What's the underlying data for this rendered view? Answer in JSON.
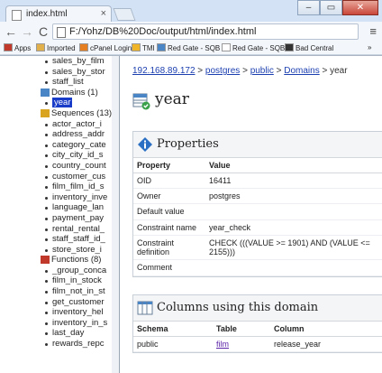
{
  "window": {
    "tab_title": "index.html",
    "tab_close": "×",
    "min": "–",
    "restore": "▭",
    "close": "✕"
  },
  "toolbar": {
    "back": "←",
    "forward": "→",
    "reload": "C",
    "url": "F:/Yohz/DB%20Doc/output/html/index.html",
    "menu": "≡"
  },
  "bookmarks": [
    {
      "label": "Apps",
      "color": "#c0392b"
    },
    {
      "label": "Imported",
      "color": "#e2b04a"
    },
    {
      "label": "cPanel Login",
      "color": "#e67e22"
    },
    {
      "label": "TMI",
      "color": "#f0b429"
    },
    {
      "label": "Red Gate - SQB 6",
      "color": "#4a86c5"
    },
    {
      "label": "Red Gate - SQB 7",
      "color": "#ffffff"
    },
    {
      "label": "Bad Central",
      "color": "#333333"
    }
  ],
  "bookmarks_more": "»",
  "tree": [
    {
      "kind": "leaf",
      "label": "sales_by_film"
    },
    {
      "kind": "leaf",
      "label": "sales_by_stor"
    },
    {
      "kind": "leaf",
      "label": "staff_list"
    },
    {
      "kind": "group",
      "label": "Domains (1)",
      "icon": "domains-icon"
    },
    {
      "kind": "leaf",
      "label": "year",
      "selected": true
    },
    {
      "kind": "group",
      "label": "Sequences (13)",
      "icon": "sequences-icon"
    },
    {
      "kind": "leaf",
      "label": "actor_actor_i"
    },
    {
      "kind": "leaf",
      "label": "address_addr"
    },
    {
      "kind": "leaf",
      "label": "category_cate"
    },
    {
      "kind": "leaf",
      "label": "city_city_id_s"
    },
    {
      "kind": "leaf",
      "label": "country_count"
    },
    {
      "kind": "leaf",
      "label": "customer_cus"
    },
    {
      "kind": "leaf",
      "label": "film_film_id_s"
    },
    {
      "kind": "leaf",
      "label": "inventory_inve"
    },
    {
      "kind": "leaf",
      "label": "language_lan"
    },
    {
      "kind": "leaf",
      "label": "payment_pay"
    },
    {
      "kind": "leaf",
      "label": "rental_rental_"
    },
    {
      "kind": "leaf",
      "label": "staff_staff_id_"
    },
    {
      "kind": "leaf",
      "label": "store_store_i"
    },
    {
      "kind": "group",
      "label": "Functions (8)",
      "icon": "functions-icon"
    },
    {
      "kind": "leaf",
      "label": "_group_conca"
    },
    {
      "kind": "leaf",
      "label": "film_in_stock"
    },
    {
      "kind": "leaf",
      "label": "film_not_in_st"
    },
    {
      "kind": "leaf",
      "label": "get_customer"
    },
    {
      "kind": "leaf",
      "label": "inventory_hel"
    },
    {
      "kind": "leaf",
      "label": "inventory_in_s"
    },
    {
      "kind": "leaf",
      "label": "last_day"
    },
    {
      "kind": "leaf",
      "label": "rewards_repc"
    }
  ],
  "breadcrumb": {
    "host": "192.168.89.172",
    "db": "postgres",
    "schema": "public",
    "section": "Domains",
    "current": "year",
    "sep": ">"
  },
  "page_title": "year",
  "properties": {
    "heading": "Properties",
    "col_property": "Property",
    "col_value": "Value",
    "rows": [
      {
        "property": "OID",
        "value": "16411"
      },
      {
        "property": "Owner",
        "value": "postgres"
      },
      {
        "property": "Default value",
        "value": ""
      },
      {
        "property": "Constraint name",
        "value": "year_check"
      },
      {
        "property": "Constraint definition",
        "value": "CHECK (((VALUE >= 1901) AND (VALUE <= 2155)))"
      },
      {
        "property": "Comment",
        "value": ""
      }
    ]
  },
  "columns_using": {
    "heading": "Columns using this domain",
    "col_schema": "Schema",
    "col_table": "Table",
    "col_column": "Column",
    "rows": [
      {
        "schema": "public",
        "table": "film",
        "column": "release_year"
      }
    ]
  }
}
